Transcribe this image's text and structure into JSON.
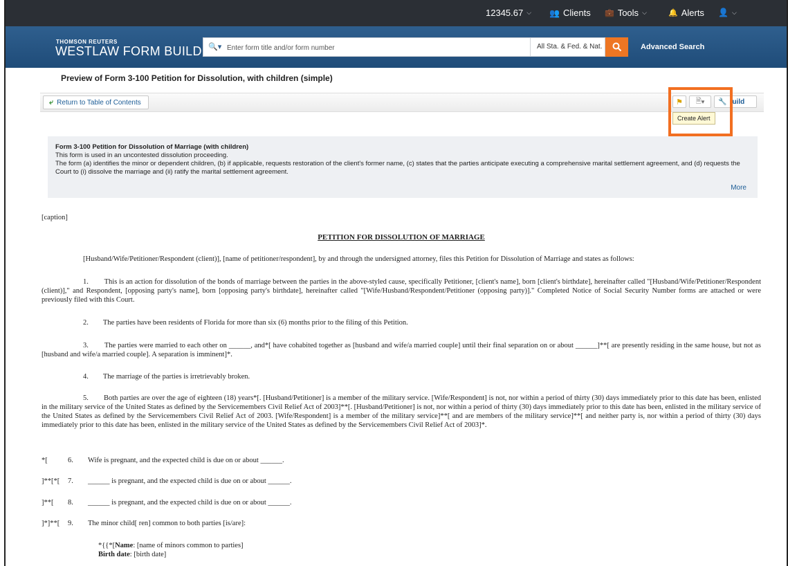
{
  "topbar": {
    "balance": "12345.67",
    "clients": "Clients",
    "tools": "Tools",
    "alerts": "Alerts",
    "icons": [
      "people-icon",
      "toolbox-icon",
      "bell-icon",
      "user-icon"
    ]
  },
  "header": {
    "brand_small": "THOMSON REUTERS",
    "brand_big": "WESTLAW FORM BUILDER",
    "brand_tm": "™",
    "search_placeholder": "Enter form title and/or form number",
    "scope": "All Sta. & Fed. & Nat.",
    "advanced_search": "Advanced Search"
  },
  "preview": {
    "title": "Preview of Form 3-100 Petition for Dissolution, with children (simple)"
  },
  "toolbar": {
    "return": "Return to Table of Contents",
    "build": "uild",
    "tooltip": "Create Alert"
  },
  "info": {
    "title": "Form 3-100 Petition for Dissolution of Marriage (with children)",
    "line1": "This form is used in an uncontested dissolution proceeding.",
    "line2": "The form (a) identifies the minor or dependent children, (b) if applicable, requests restoration of the client's former name, (c) states that the parties anticipate executing a comprehensive marital settlement agreement, and (d) requests the Court to (i) dissolve the marriage and (ii) ratify the marital settlement agreement.",
    "more": "More"
  },
  "doc": {
    "caption": "[caption]",
    "heading": "PETITION FOR DISSOLUTION OF MARRIAGE",
    "intro": "[Husband/Wife/Petitioner/Respondent (client)], [name of petitioner/respondent], by and through the undersigned attorney, files this Petition for Dissolution of Marriage and states as follows:",
    "p1": "1.        This is an action for dissolution of the bonds of marriage between the parties in the above-styled cause, specifically Petitioner, [client's name], born [client's birthdate], hereinafter called \"[Husband/Wife/Petitioner/Respondent (client)],\" and Respondent, [opposing party's name], born [opposing party's birthdate], hereinafter called \"[Wife/Husband/Respondent/Petitioner (opposing party)].\"  Completed Notice of Social Security Number forms are attached or were previously filed with this Court.",
    "p2": "2.        The parties have been residents of Florida for more than six (6) months prior to the filing of this Petition.",
    "p3": "3.        The parties were married to each other on ______, and*[ have cohabited together as [husband and wife/a married couple] until their final separation on or about ______]**[ are presently residing in the same house, but not as [husband and wife/a married couple].  A separation is imminent]*.",
    "p4": "4.        The marriage of the parties is irretrievably broken.",
    "p5": "5.        Both parties are over the age of eighteen (18) years*[.  [Husband/Petitioner] is a member of the military service.  [Wife/Respondent] is not, nor within a period of thirty (30) days immediately prior to this date has been, enlisted in the military service of the United States as defined by the Servicemembers Civil Relief Act of 2003]**[.  [Husband/Petitioner] is not, nor within a period of thirty (30) days immediately prior to this date has been, enlisted in the military service of the United States as defined by the Servicemembers Civil Relief Act of 2003.  [Wife/Respondent] is a member of the military service]**[ and are members of the military service]**[ and neither party is, nor within a period of thirty (30) days immediately prior to this date has been, enlisted in the military service of the United States as defined by the Servicemembers Civil Relief Act of 2003]*.",
    "items": [
      {
        "marker": "*[",
        "num": "6.",
        "text": "Wife is pregnant, and the expected child is due on or about ______."
      },
      {
        "marker": "]**[*[",
        "num": "7.",
        "text": "______ is pregnant, and the expected child is due on or about ______."
      },
      {
        "marker": "]**[",
        "num": "8.",
        "text": "______ is pregnant, and the expected child is due on or about ______."
      },
      {
        "marker": "]*]**[",
        "num": "9.",
        "text": "The minor child[ ren] common to both parties [is/are]:"
      }
    ],
    "child_prefix": "*{{*[",
    "child_name_label": "Name",
    "child_name_value": ":  [name of minors common to parties]",
    "child_birth_label": "Birth date",
    "child_birth_value": ":  [birth date]"
  }
}
